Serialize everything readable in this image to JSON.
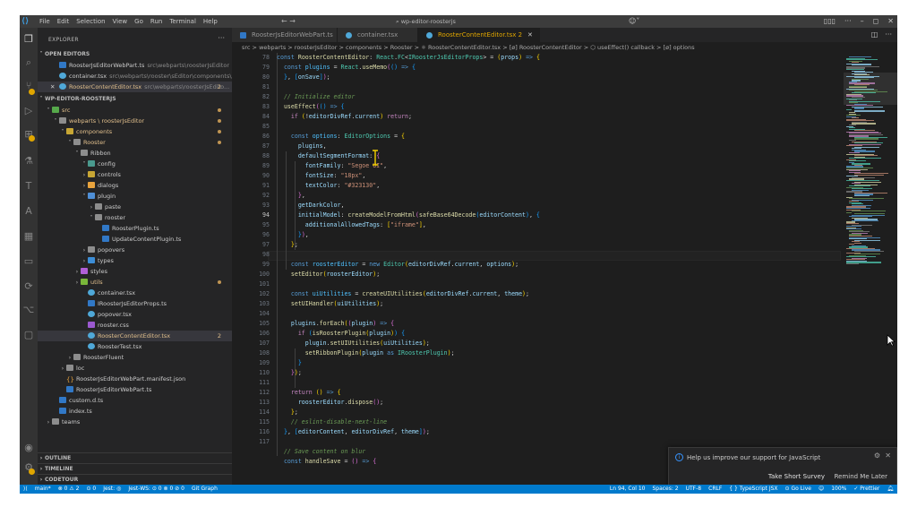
{
  "titlebar": {
    "menu": [
      "File",
      "Edit",
      "Selection",
      "View",
      "Go",
      "Run",
      "Terminal",
      "Help"
    ],
    "nav": "←  →",
    "search": "wp-editor-roosterjs"
  },
  "sidebar": {
    "header": "EXPLORER",
    "more": "···",
    "open_editors": "OPEN EDITORS",
    "open_files": [
      {
        "name": "RoosterJsEditorWebPart.ts",
        "path": "src\\webparts\\roosterJsEditor"
      },
      {
        "name": "container.tsx",
        "path": "src\\webparts\\rooster\\sEditor\\components\\A..."
      },
      {
        "name": "RoosterContentEditor.tsx",
        "path": "src\\webparts\\roosterJsEdito...",
        "badge": "2"
      }
    ],
    "workspace": "WP-EDITOR-ROOSTERJS",
    "tree": [
      {
        "label": "src"
      },
      {
        "label": "webparts \\ roosterJsEditor"
      },
      {
        "label": "components"
      },
      {
        "label": "Rooster"
      },
      {
        "label": "Ribbon"
      },
      {
        "label": "config"
      },
      {
        "label": "controls"
      },
      {
        "label": "dialogs"
      },
      {
        "label": "plugin"
      },
      {
        "label": "paste"
      },
      {
        "label": "rooster"
      },
      {
        "label": "RoosterPlugin.ts"
      },
      {
        "label": "UpdateContentPlugin.ts"
      },
      {
        "label": "popovers"
      },
      {
        "label": "types"
      },
      {
        "label": "styles"
      },
      {
        "label": "utils"
      },
      {
        "label": "container.tsx"
      },
      {
        "label": "IRoosterJsEditorProps.ts"
      },
      {
        "label": "popover.tsx"
      },
      {
        "label": "rooster.css"
      },
      {
        "label": "RoosterContentEditor.tsx",
        "badge": "2"
      },
      {
        "label": "RoosterTest.tsx"
      },
      {
        "label": "RoosterFluent"
      },
      {
        "label": "loc"
      },
      {
        "label": "RoosterJsEditorWebPart.manifest.json"
      },
      {
        "label": "RoosterJsEditorWebPart.ts"
      },
      {
        "label": "custom.d.ts"
      },
      {
        "label": "index.ts"
      },
      {
        "label": "teams"
      }
    ],
    "outline": "OUTLINE",
    "timeline": "TIMELINE",
    "codetour": "CODETOUR"
  },
  "tabs": [
    {
      "label": "RoosterJsEditorWebPart.ts"
    },
    {
      "label": "container.tsx"
    },
    {
      "label": "RoosterContentEditor.tsx 2",
      "close": "✕"
    }
  ],
  "breadcrumb": "src > webparts > roosterJsEditor > components > Rooster > ⚛ RoosterContentEditor.tsx > [ø] RoosterContentEditor > ⬡ useEffect() callback > [ø] options",
  "editor": {
    "line_numbers": [
      "78",
      "79",
      "80",
      "81",
      "82",
      "83",
      "84",
      "85",
      "86",
      "87",
      "88",
      "89",
      "90",
      "91",
      "92",
      "93",
      "94",
      "95",
      "96",
      "97",
      "98",
      "99",
      "100",
      "101",
      "102",
      "103",
      "104",
      "105",
      "106",
      "107",
      "108",
      "109",
      "110",
      "111",
      "112",
      "113",
      "114",
      "115",
      "116",
      "117"
    ],
    "current_line": "94"
  },
  "notification": {
    "message": "Help us improve our support for JavaScript",
    "primary": "Take Short Survey",
    "secondary": "Remind Me Later"
  },
  "statusbar": {
    "left": [
      "main*",
      "⊗ 0 ⚠ 2",
      "⊙ 0",
      "Jest: ◎",
      "Jest-WS: ⊙ 0 ⊗ 0 ⊘ 0",
      "Git Graph"
    ],
    "right": [
      "Ln 94, Col 10",
      "Spaces: 2",
      "UTF-8",
      "CRLF",
      "{ } TypeScript JSX",
      "⊙ Go Live",
      "100%",
      "✓ Prettier"
    ]
  },
  "colors": {
    "statusbar": "#007acc",
    "modified": "#e2c08d",
    "error": "#f14c4c",
    "active_tab_text": "#e0a600"
  }
}
